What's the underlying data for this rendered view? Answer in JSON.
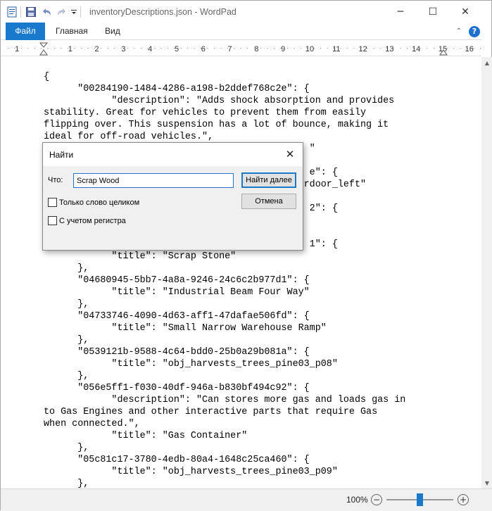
{
  "window": {
    "title": "inventoryDescriptions.json - WordPad",
    "controls": {
      "minimize": "─",
      "maximize": "☐",
      "close": "✕"
    }
  },
  "quick_access": {
    "icons": [
      "wordpad-doc-icon",
      "save-icon",
      "undo-icon",
      "redo-icon",
      "customize-dropdown-icon"
    ]
  },
  "ribbon": {
    "tabs": [
      {
        "label": "Файл"
      },
      {
        "label": "Главная"
      },
      {
        "label": "Вид"
      }
    ],
    "help_label": "?"
  },
  "ruler": {
    "numbers": [
      "1",
      "1",
      "2",
      "3",
      "4",
      "5",
      "6",
      "7",
      "8",
      "9",
      "10",
      "11",
      "12",
      "13",
      "14",
      "15",
      "16"
    ]
  },
  "document": {
    "text": "{\n      \"00284190-1484-4286-a198-b2ddef768c2e\": {\n            \"description\": \"Adds shock absorption and provides\nstability. Great for vehicles to prevent them from easily\nflipping over. This suspension has a lot of bounce, making it\nideal for off-road vehicles.\",\n                                               \"\n\n                                               e\": {\n                                         evatordoor_left\"\n\n                                               2\": {\n\n\n                                               1\": {\n            \"title\": \"Scrap Stone\"\n      },\n      \"04680945-5bb7-4a8a-9246-24c6c2b977d1\": {\n            \"title\": \"Industrial Beam Four Way\"\n      },\n      \"04733746-4090-4d63-aff1-47dafae506fd\": {\n            \"title\": \"Small Narrow Warehouse Ramp\"\n      },\n      \"0539121b-9588-4c64-bdd0-25b0a29b081a\": {\n            \"title\": \"obj_harvests_trees_pine03_p08\"\n      },\n      \"056e5ff1-f030-40df-946a-b830bf494c92\": {\n            \"description\": \"Can stores more gas and loads gas in\nto Gas Engines and other interactive parts that require Gas\nwhen connected.\",\n            \"title\": \"Gas Container\"\n      },\n      \"05c81c17-3780-4edb-80a4-1648c25ca460\": {\n            \"title\": \"obj_harvests_trees_pine03_p09\"\n      },"
  },
  "find_dialog": {
    "title": "Найти",
    "find_what_label": "Что:",
    "find_what_value": "Scrap Wood",
    "find_next_button": "Найти далее",
    "cancel_button": "Отмена",
    "match_whole_word_label": "Только слово целиком",
    "match_case_label": "С учетом регистра"
  },
  "status": {
    "zoom_level": "100%",
    "zoom_minus": "−",
    "zoom_plus": "+"
  },
  "colors": {
    "file_tab": "#1979ca",
    "accent": "#1979ca"
  }
}
